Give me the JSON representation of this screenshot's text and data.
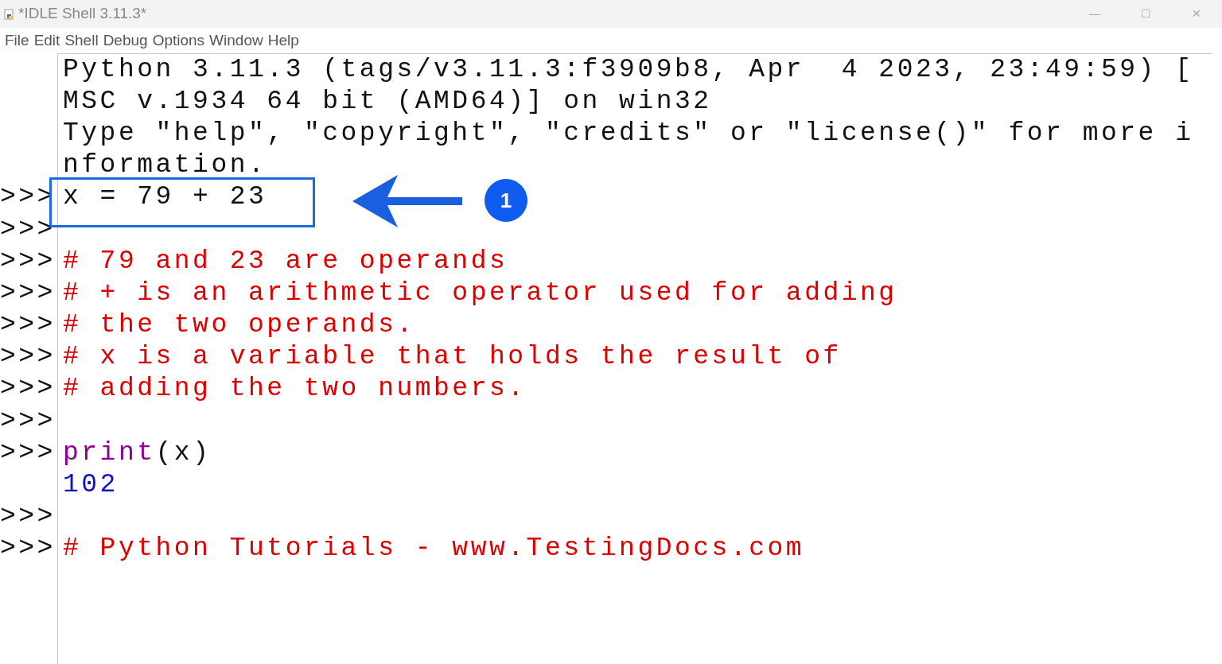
{
  "window": {
    "title": "*IDLE Shell 3.11.3*",
    "controls": [
      "—",
      "☐",
      "✕"
    ]
  },
  "menu": [
    "File",
    "Edit",
    "Shell",
    "Debug",
    "Options",
    "Window",
    "Help"
  ],
  "lines": [
    {
      "segments": [
        {
          "kind": "output",
          "text": "Python 3.11.3 (tags/v3.11.3:f3909b8, Apr  4 2023, 23:49:59) ["
        }
      ]
    },
    {
      "segments": [
        {
          "kind": "output",
          "text": "MSC v.1934 64 bit (AMD64)] on win32"
        }
      ]
    },
    {
      "segments": [
        {
          "kind": "output",
          "text": "Type \"help\", \"copyright\", \"credits\" or \"license()\" for more i"
        }
      ]
    },
    {
      "segments": [
        {
          "kind": "output",
          "text": "nformation."
        }
      ]
    },
    {
      "prompt": ">>>",
      "segments": [
        {
          "kind": "code",
          "text": "x = 79 + 23"
        }
      ]
    },
    {
      "prompt": ">>>"
    },
    {
      "prompt": ">>>",
      "segments": [
        {
          "kind": "comment",
          "text": "# 79 and 23 are operands"
        }
      ]
    },
    {
      "prompt": ">>>",
      "segments": [
        {
          "kind": "comment",
          "text": "# + is an arithmetic operator used for adding"
        }
      ]
    },
    {
      "prompt": ">>>",
      "segments": [
        {
          "kind": "comment",
          "text": "# the two operands."
        }
      ]
    },
    {
      "prompt": ">>>",
      "segments": [
        {
          "kind": "comment",
          "text": "# x is a variable that holds the result of"
        }
      ]
    },
    {
      "prompt": ">>>",
      "segments": [
        {
          "kind": "comment",
          "text": "# adding the two numbers."
        }
      ]
    },
    {
      "prompt": ">>>"
    },
    {
      "prompt": ">>>",
      "segments": [
        {
          "kind": "builtin",
          "text": "print"
        },
        {
          "kind": "code",
          "text": "(x)"
        }
      ]
    },
    {
      "segments": [
        {
          "kind": "result",
          "text": "102"
        }
      ]
    },
    {
      "prompt": ">>>"
    },
    {
      "prompt": ">>>",
      "segments": [
        {
          "kind": "comment",
          "text": "# Python Tutorials - www.TestingDocs.com"
        }
      ]
    }
  ],
  "callout": {
    "badge": "1"
  }
}
